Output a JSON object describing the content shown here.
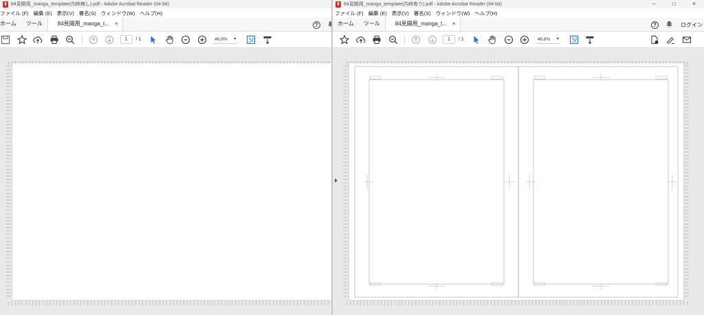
{
  "left_window": {
    "title": "84見開用_manga_template(内枠無し).pdf - Adobe Acrobat Reader (64-bit)",
    "menu": [
      "ファイル (F)",
      "編集 (E)",
      "表示(V)",
      "署名(S)",
      "ウィンドウ(W)",
      "ヘルプ(H)"
    ],
    "tabs": {
      "home": "ホーム",
      "tools": "ツール",
      "doc": "84見開用_manga_t...",
      "close": "×"
    },
    "page_current": "1",
    "page_total": "/ 1",
    "zoom": "46.8%"
  },
  "right_window": {
    "title": "84見開用_manga_template(内枠有り).pdf - Adobe Acrobat Reader (64-bit)",
    "menu": [
      "ファイル (F)",
      "編集 (E)",
      "表示(V)",
      "署名(S)",
      "ウィンドウ(W)",
      "ヘルプ(H)"
    ],
    "tabs": {
      "home": "ホーム",
      "tools": "ツール",
      "doc": "84見開用_manga_t...",
      "close": "×"
    },
    "page_current": "1",
    "page_total": "/ 1",
    "zoom": "46.8%",
    "login": "ログイン"
  },
  "window_controls": {
    "minimize": "–",
    "maximize": "□",
    "close": "×"
  },
  "icons": [
    "save-icon",
    "star-icon",
    "upload-icon",
    "print-icon",
    "zoom-out-search-icon",
    "arrow-up-icon",
    "arrow-down-icon",
    "select-cursor-icon",
    "hand-icon",
    "minus-circle-icon",
    "plus-circle-icon",
    "fit-page-icon",
    "scroll-mode-icon",
    "export-pdf-icon",
    "sign-icon",
    "mail-icon",
    "help-icon",
    "bell-icon"
  ],
  "colors": {
    "accent": "#1473e6",
    "pdf_red": "#d4311f",
    "canvas": "#e9e9e9"
  }
}
